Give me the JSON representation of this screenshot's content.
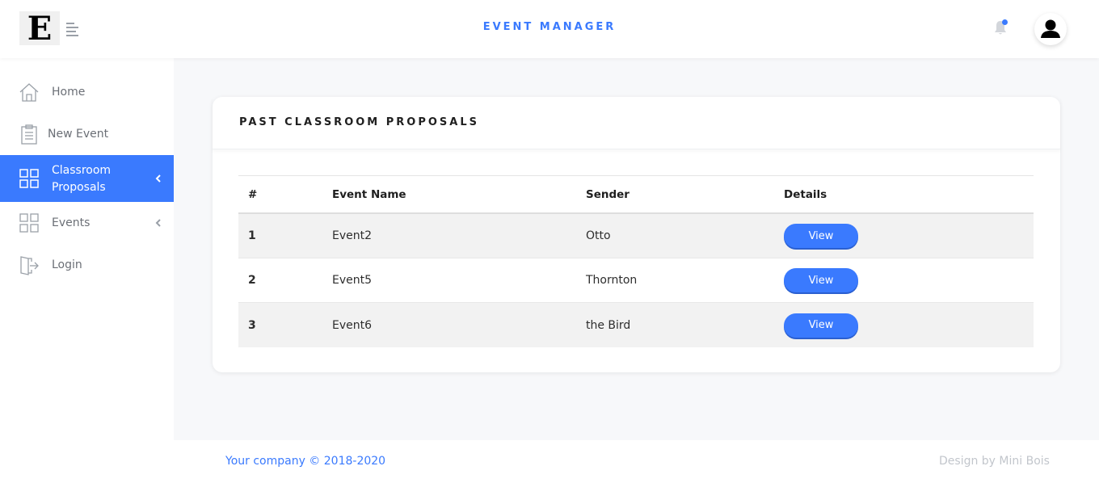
{
  "header": {
    "logo_letter": "E",
    "title": "EVENT MANAGER",
    "accent_color": "#3a7afe",
    "icons": [
      "menu-icon",
      "bell-icon",
      "user-avatar-icon"
    ]
  },
  "sidebar": {
    "items": [
      {
        "label": "Home",
        "icon": "home-icon",
        "active": false
      },
      {
        "label": "New Event",
        "icon": "clipboard-icon",
        "active": false
      },
      {
        "label": "Classroom Proposals",
        "label_line1": "Classroom",
        "label_line2": "Proposals",
        "icon": "grid-icon",
        "active": true,
        "has_submenu": true
      },
      {
        "label": "Events",
        "icon": "grid-icon",
        "active": false,
        "has_submenu": true
      },
      {
        "label": "Login",
        "icon": "login-icon",
        "active": false
      }
    ]
  },
  "card": {
    "title": "PAST CLASSROOM PROPOSALS",
    "table": {
      "columns": [
        "#",
        "Event Name",
        "Sender",
        "Details"
      ],
      "rows": [
        {
          "num": "1",
          "event": "Event2",
          "sender": "Otto",
          "action": "View"
        },
        {
          "num": "2",
          "event": "Event5",
          "sender": "Thornton",
          "action": "View"
        },
        {
          "num": "3",
          "event": "Event6",
          "sender": "the Bird",
          "action": "View"
        }
      ]
    }
  },
  "footer": {
    "copyright": "Your company © 2018-2020",
    "credit": "Design by Mini Bois"
  }
}
